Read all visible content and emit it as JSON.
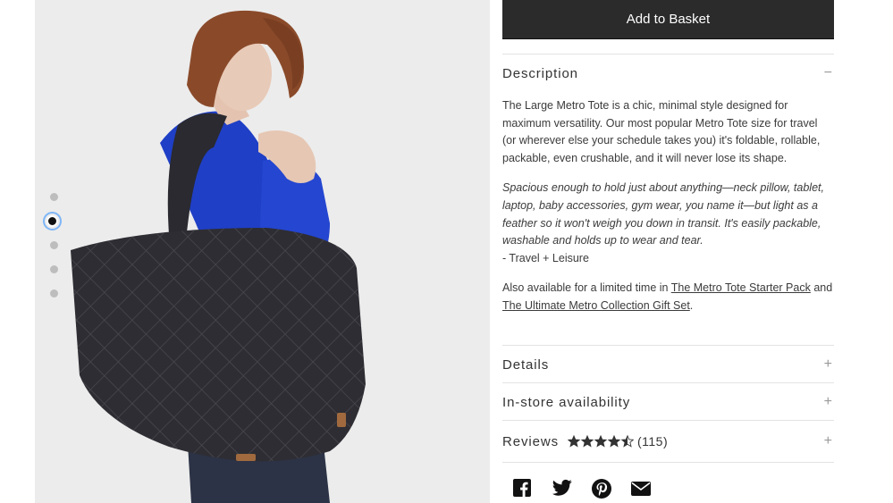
{
  "product": {
    "add_to_basket_label": "Add to Basket"
  },
  "gallery": {
    "image_alt": "Model carrying a black quilted Large Metro Tote over her shoulder",
    "dots": 5,
    "active_dot": 2
  },
  "description": {
    "title": "Description",
    "toggle": "−",
    "paragraph1": "The Large Metro Tote is a chic, minimal style designed for maximum versatility. Our most popular Metro Tote size for travel (or wherever else your schedule takes you) it's foldable, rollable, packable, even crushable, and it will never lose its shape.",
    "quote": "Spacious enough to hold just about anything—neck pillow, tablet, laptop, baby accessories, gym wear, you name it—but light as a feather so it won't weigh you down in transit. It's easily packable, washable and holds up to wear and tear.",
    "quote_source": "- Travel + Leisure",
    "also_prefix": "Also available for a limited time in ",
    "link1": "The Metro Tote Starter Pack",
    "also_middle": " and ",
    "link2": "The Ultimate Metro Collection Gift Set",
    "also_suffix": "."
  },
  "details": {
    "title": "Details",
    "toggle": "+"
  },
  "availability": {
    "title": "In-store availability",
    "toggle": "+"
  },
  "reviews": {
    "title": "Reviews",
    "rating": 4.5,
    "count": "(115)",
    "toggle": "+"
  },
  "share": [
    "facebook-icon",
    "twitter-icon",
    "pinterest-icon",
    "email-icon"
  ],
  "colors": {
    "button": "#2b2b2b",
    "star": "#333333",
    "divider": "#e3e3e3"
  }
}
